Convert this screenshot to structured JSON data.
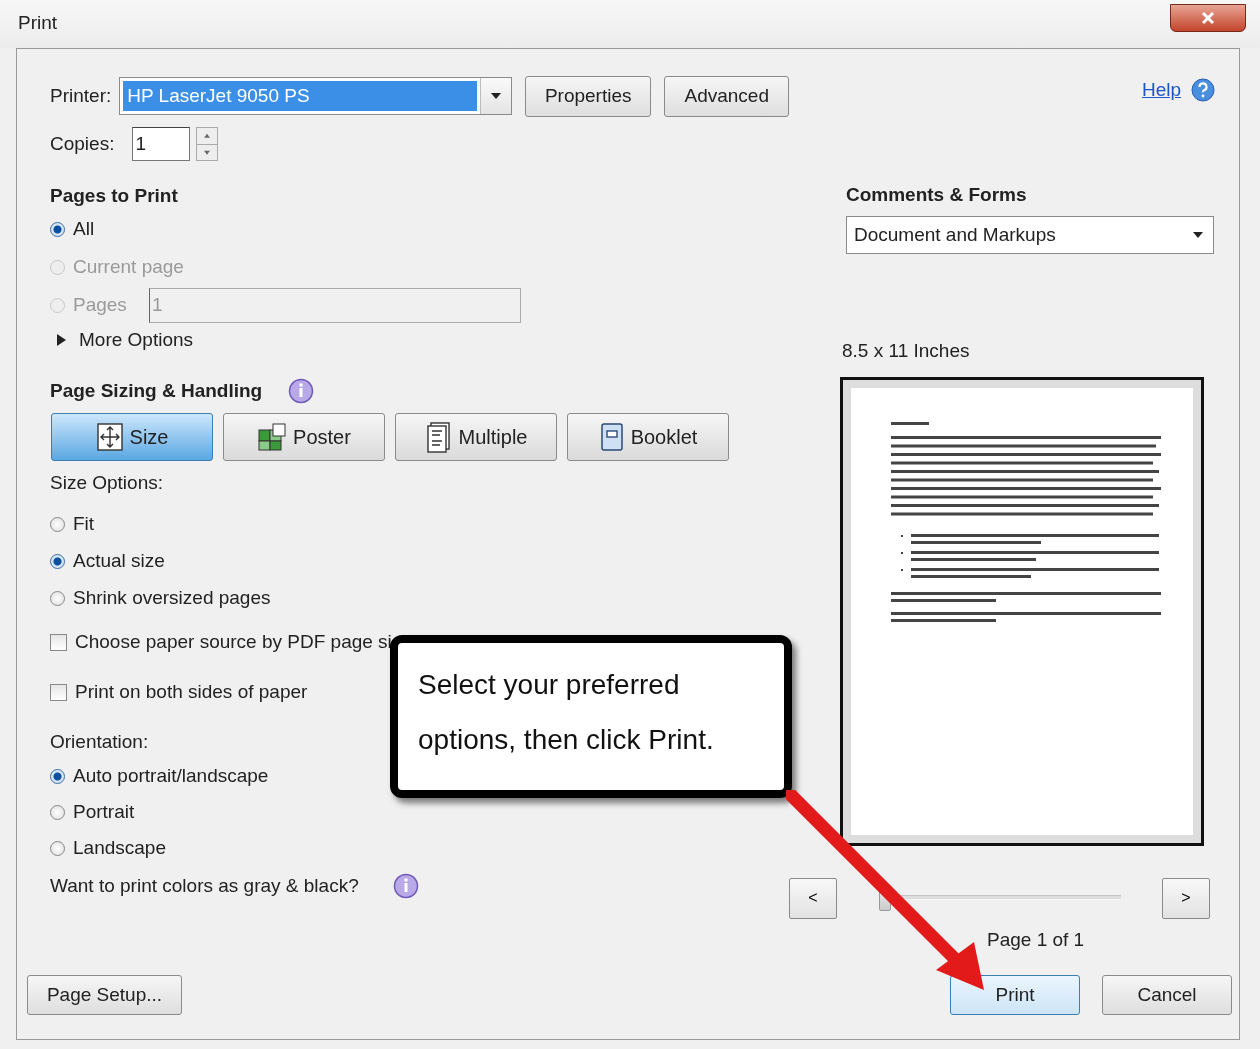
{
  "window": {
    "title": "Print"
  },
  "printer": {
    "label": "Printer:",
    "value": "HP LaserJet 9050 PS"
  },
  "top_buttons": [
    {
      "label": "Properties"
    },
    {
      "label": "Advanced"
    }
  ],
  "help": {
    "label": "Help"
  },
  "copies": {
    "label": "Copies:",
    "value": "1"
  },
  "pages_to_print": {
    "heading": "Pages to Print",
    "options": [
      {
        "kind": "radio",
        "label": "All",
        "selected": true,
        "disabled": false
      },
      {
        "kind": "radio",
        "label": "Current page",
        "selected": false,
        "disabled": true
      },
      {
        "kind": "range",
        "label": "Pages",
        "selected": false,
        "disabled": true,
        "value": "1"
      }
    ],
    "more_options": {
      "label": "More Options",
      "expanded": false
    }
  },
  "page_sizing": {
    "heading": "Page Sizing & Handling",
    "modes": [
      {
        "kind": "size",
        "label": "Size",
        "selected": true
      },
      {
        "kind": "poster",
        "label": "Poster",
        "selected": false
      },
      {
        "kind": "multiple",
        "label": "Multiple",
        "selected": false
      },
      {
        "kind": "booklet",
        "label": "Booklet",
        "selected": false
      }
    ],
    "size_options_label": "Size Options:",
    "size_options": [
      {
        "label": "Fit",
        "selected": false
      },
      {
        "label": "Actual size",
        "selected": true
      },
      {
        "label": "Shrink oversized pages",
        "selected": false
      }
    ],
    "checkboxes": [
      {
        "label": "Choose paper source by PDF page si",
        "checked": false
      },
      {
        "label": "Print on both sides of paper",
        "checked": false
      }
    ],
    "orientation_label": "Orientation:",
    "orientation": [
      {
        "label": "Auto portrait/landscape",
        "selected": true
      },
      {
        "label": "Portrait",
        "selected": false
      },
      {
        "label": "Landscape",
        "selected": false
      }
    ],
    "gray_question": "Want to print colors as gray & black?"
  },
  "comments_forms": {
    "heading": "Comments & Forms",
    "value": "Document and Markups"
  },
  "preview": {
    "paper_size": "8.5 x 11 Inches",
    "prev": "<",
    "next": ">",
    "level": 0,
    "page": "Page 1 of 1"
  },
  "footer": {
    "page_setup": "Page Setup...",
    "print": "Print",
    "cancel": "Cancel"
  },
  "callout": {
    "text": "Select your preferred options, then click Print."
  }
}
